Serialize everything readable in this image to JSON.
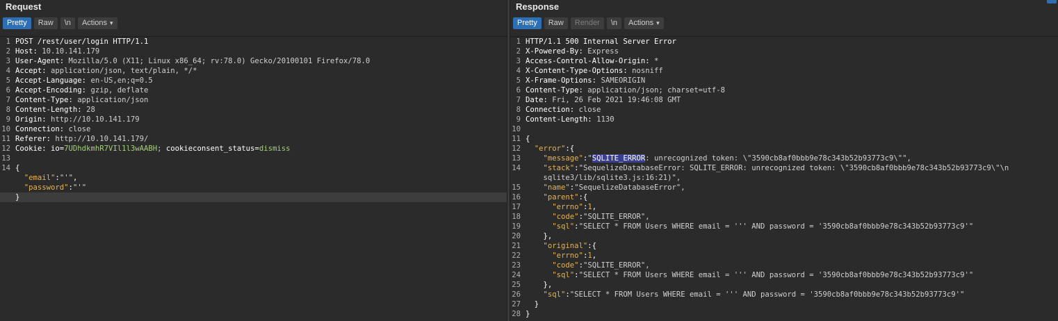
{
  "request": {
    "title": "Request",
    "tabs": {
      "pretty": "Pretty",
      "raw": "Raw",
      "newline": "\\n",
      "actions": "Actions"
    },
    "lines": {
      "l1": {
        "n": "1",
        "text": "POST /rest/user/login HTTP/1.1"
      },
      "l2": {
        "n": "2",
        "key": "Host: ",
        "val": "10.10.141.179"
      },
      "l3": {
        "n": "3",
        "key": "User-Agent: ",
        "val": "Mozilla/5.0 (X11; Linux x86_64; rv:78.0) Gecko/20100101 Firefox/78.0"
      },
      "l4": {
        "n": "4",
        "key": "Accept: ",
        "val": "application/json, text/plain, */*"
      },
      "l5": {
        "n": "5",
        "key": "Accept-Language: ",
        "val": "en-US,en;q=0.5"
      },
      "l6": {
        "n": "6",
        "key": "Accept-Encoding: ",
        "val": "gzip, deflate"
      },
      "l7": {
        "n": "7",
        "key": "Content-Type: ",
        "val": "application/json"
      },
      "l8": {
        "n": "8",
        "key": "Content-Length: ",
        "val": "28"
      },
      "l9": {
        "n": "9",
        "key": "Origin: ",
        "val": "http://10.10.141.179"
      },
      "l10": {
        "n": "10",
        "key": "Connection: ",
        "val": "close"
      },
      "l11": {
        "n": "11",
        "key": "Referer: ",
        "val": "http://10.10.141.179/"
      },
      "l12": {
        "n": "12",
        "key": "Cookie: ",
        "c1name": "io=",
        "c1val": "7UDhdkmhR7VIl1l3wAABH",
        "sep": "; ",
        "c2name": "cookieconsent_status=",
        "c2val": "dismiss"
      },
      "l13": {
        "n": "13"
      },
      "l14": {
        "n": "14",
        "text": "{"
      },
      "l15": {
        "indent": "  ",
        "k": "\"email\"",
        "colon": ":",
        "v": "\"'\"",
        "comma": ","
      },
      "l16": {
        "indent": "  ",
        "k": "\"password\"",
        "colon": ":",
        "v": "\"'\""
      },
      "l17": {
        "text": "}"
      }
    }
  },
  "response": {
    "title": "Response",
    "tabs": {
      "pretty": "Pretty",
      "raw": "Raw",
      "render": "Render",
      "newline": "\\n",
      "actions": "Actions"
    },
    "lines": {
      "l1": {
        "n": "1",
        "text": "HTTP/1.1 500 Internal Server Error"
      },
      "l2": {
        "n": "2",
        "key": "X-Powered-By: ",
        "val": "Express"
      },
      "l3": {
        "n": "3",
        "key": "Access-Control-Allow-Origin: ",
        "val": "*"
      },
      "l4": {
        "n": "4",
        "key": "X-Content-Type-Options: ",
        "val": "nosniff"
      },
      "l5": {
        "n": "5",
        "key": "X-Frame-Options: ",
        "val": "SAMEORIGIN"
      },
      "l6": {
        "n": "6",
        "key": "Content-Type: ",
        "val": "application/json; charset=utf-8"
      },
      "l7": {
        "n": "7",
        "key": "Date: ",
        "val": "Fri, 26 Feb 2021 19:46:08 GMT"
      },
      "l8": {
        "n": "8",
        "key": "Connection: ",
        "val": "close"
      },
      "l9": {
        "n": "9",
        "key": "Content-Length: ",
        "val": "1130"
      },
      "l10": {
        "n": "10"
      },
      "l11": {
        "n": "11",
        "text": "{"
      },
      "l12": {
        "n": "12",
        "indent": "  ",
        "k": "\"error\"",
        "rest": ":{"
      },
      "l13": {
        "n": "13",
        "indent": "    ",
        "k": "\"message\"",
        "colon": ":",
        "q": "\"",
        "sel": "SQLITE_ERROR",
        "rest": ": unrecognized token: \\\"3590cb8af0bbb9e78c343b52b93773c9\\\"\","
      },
      "l14": {
        "n": "14",
        "indent": "    ",
        "k": "\"stack\"",
        "colon": ":",
        "v": "\"SequelizeDatabaseError: SQLITE_ERROR: unrecognized token: \\\"3590cb8af0bbb9e78c343b52b93773c9\\\"\\n"
      },
      "l14b": {
        "indent": "    ",
        "v": "sqlite3/lib/sqlite3.js:16:21)\","
      },
      "l15": {
        "n": "15",
        "indent": "    ",
        "k": "\"name\"",
        "colon": ":",
        "v": "\"SequelizeDatabaseError\","
      },
      "l16": {
        "n": "16",
        "indent": "    ",
        "k": "\"parent\"",
        "rest": ":{"
      },
      "l17": {
        "n": "17",
        "indent": "      ",
        "k": "\"errno\"",
        "colon": ":",
        "v": "1",
        "comma": ","
      },
      "l18": {
        "n": "18",
        "indent": "      ",
        "k": "\"code\"",
        "colon": ":",
        "v": "\"SQLITE_ERROR\","
      },
      "l19": {
        "n": "19",
        "indent": "      ",
        "k": "\"sql\"",
        "colon": ":",
        "v": "\"SELECT * FROM Users WHERE email = ''' AND password = '3590cb8af0bbb9e78c343b52b93773c9'\""
      },
      "l20": {
        "n": "20",
        "text": "    },"
      },
      "l21": {
        "n": "21",
        "indent": "    ",
        "k": "\"original\"",
        "rest": ":{"
      },
      "l22": {
        "n": "22",
        "indent": "      ",
        "k": "\"errno\"",
        "colon": ":",
        "v": "1",
        "comma": ","
      },
      "l23": {
        "n": "23",
        "indent": "      ",
        "k": "\"code\"",
        "colon": ":",
        "v": "\"SQLITE_ERROR\","
      },
      "l24": {
        "n": "24",
        "indent": "      ",
        "k": "\"sql\"",
        "colon": ":",
        "v": "\"SELECT * FROM Users WHERE email = ''' AND password = '3590cb8af0bbb9e78c343b52b93773c9'\""
      },
      "l25": {
        "n": "25",
        "text": "    },"
      },
      "l26": {
        "n": "26",
        "indent": "    ",
        "k": "\"sql\"",
        "colon": ":",
        "v": "\"SELECT * FROM Users WHERE email = ''' AND password = '3590cb8af0bbb9e78c343b52b93773c9'\""
      },
      "l27": {
        "n": "27",
        "text": "  }"
      },
      "l28": {
        "n": "28",
        "text": "}"
      }
    }
  },
  "icons": {
    "divider_grip": "drag-handle-icon",
    "actions_chevron": "chevron-down-icon",
    "layout": "layout-icon"
  },
  "colors": {
    "accent": "#2e6fb4",
    "background": "#2b2b2b",
    "key_orange": "#e6b450",
    "cookie_green": "#a6ce7a",
    "selection": "#3a3f8f"
  }
}
